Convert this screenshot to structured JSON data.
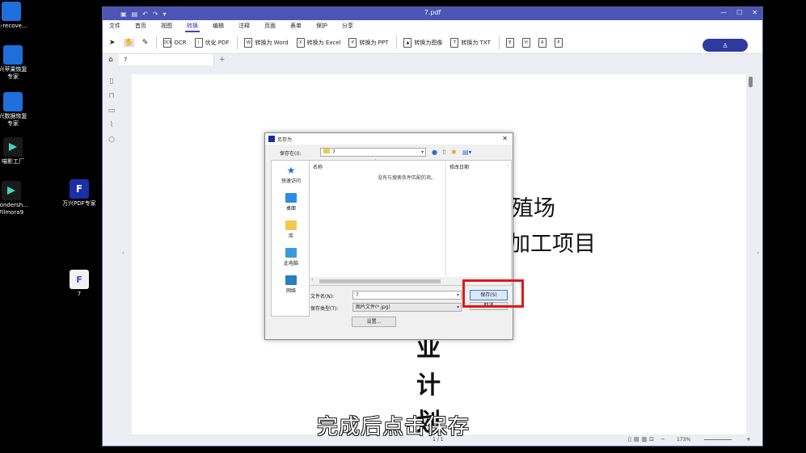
{
  "desktop": {
    "icons": [
      {
        "label": "ts-recove..."
      },
      {
        "label": "兴苹果恢复\n专家"
      },
      {
        "label": "兴数据恢复\n专家"
      },
      {
        "label": "喵影工厂"
      },
      {
        "label": "Wondersh...\nFilmora9"
      },
      {
        "label": "万兴PDF专家"
      },
      {
        "label": "7"
      }
    ]
  },
  "app": {
    "title": "7.pdf",
    "menu": [
      "文件",
      "首页",
      "视图",
      "转换",
      "编辑",
      "注释",
      "页面",
      "表单",
      "保护",
      "分享"
    ],
    "active_menu": "转换",
    "toolbar": {
      "ocr": "OCR",
      "optimize": "优化 PDF",
      "to_word": "转换为 Word",
      "to_excel": "转换为 Excel",
      "to_ppt": "转换为 PPT",
      "to_image": "转换为图像",
      "to_txt": "转换为 TXT"
    },
    "tab": {
      "label": "7"
    },
    "document": {
      "line1": "殖场",
      "line2": "加工项目",
      "vertical": [
        "业",
        "计",
        "划"
      ]
    },
    "status": {
      "page": "1 / 1",
      "zoom": "173%"
    }
  },
  "dialog": {
    "title": "另存为",
    "save_in_label": "保存在(I):",
    "save_in_value": "7",
    "places": [
      "快速访问",
      "桌面",
      "库",
      "此电脑",
      "网络"
    ],
    "columns": {
      "name": "名称",
      "modified": "修改日期"
    },
    "empty_message": "没有与搜索条件匹配的项。",
    "filename_label": "文件名(N):",
    "filename_value": "7",
    "filetype_label": "保存类型(T):",
    "filetype_value": "图片文件(*.jpg)",
    "save_button": "保存(S)",
    "cancel_button": "取消",
    "settings_button": "设置..."
  },
  "subtitle": "完成后点击保存",
  "colors": {
    "titlebar": "#4c55b5",
    "accent": "#2e3a9e",
    "highlight": "#e01818"
  }
}
